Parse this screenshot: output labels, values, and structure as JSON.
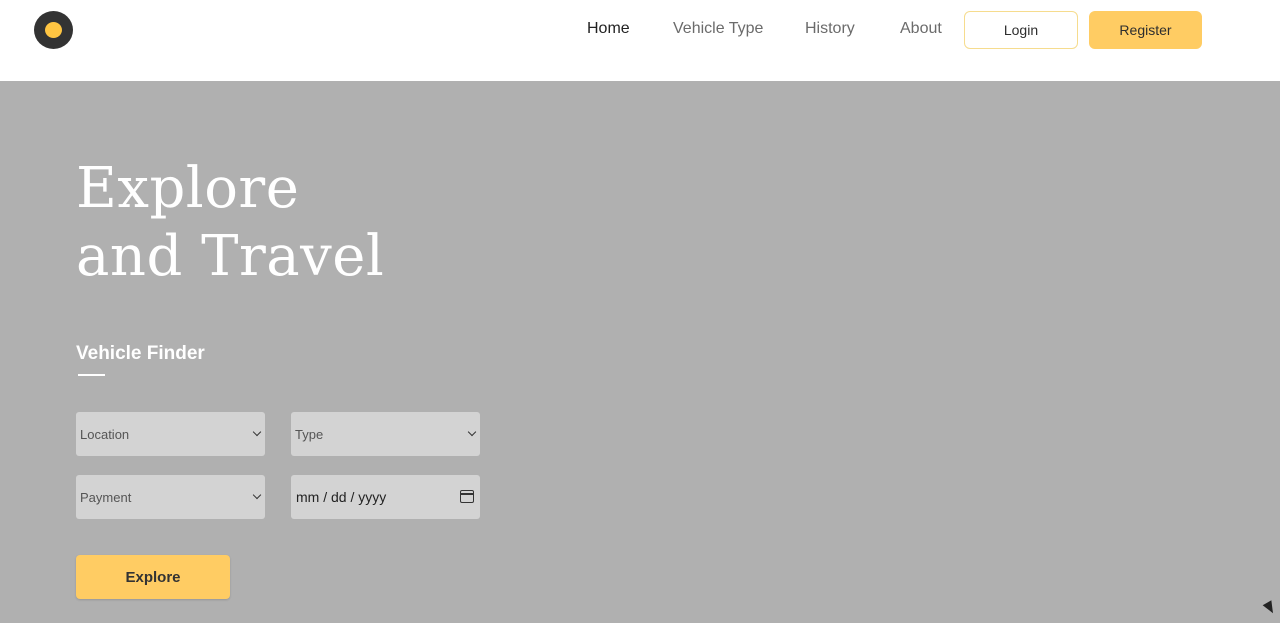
{
  "header": {
    "nav": [
      {
        "label": "Home",
        "active": true
      },
      {
        "label": "Vehicle Type",
        "active": false
      },
      {
        "label": "History",
        "active": false
      },
      {
        "label": "About",
        "active": false
      }
    ],
    "login_label": "Login",
    "register_label": "Register",
    "logo_icon": "logo-icon"
  },
  "hero": {
    "title_line1": "Explore",
    "title_line2": "and Travel"
  },
  "finder": {
    "heading": "Vehicle Finder",
    "location_placeholder": "Location",
    "type_placeholder": "Type",
    "payment_placeholder": "Payment",
    "date_placeholder": "mm / dd / yyyy",
    "explore_label": "Explore"
  },
  "colors": {
    "accent": "#ffcc63",
    "hero_background": "#b0b0b0",
    "field_background": "#d3d3d3",
    "logo_dark": "#333333"
  }
}
